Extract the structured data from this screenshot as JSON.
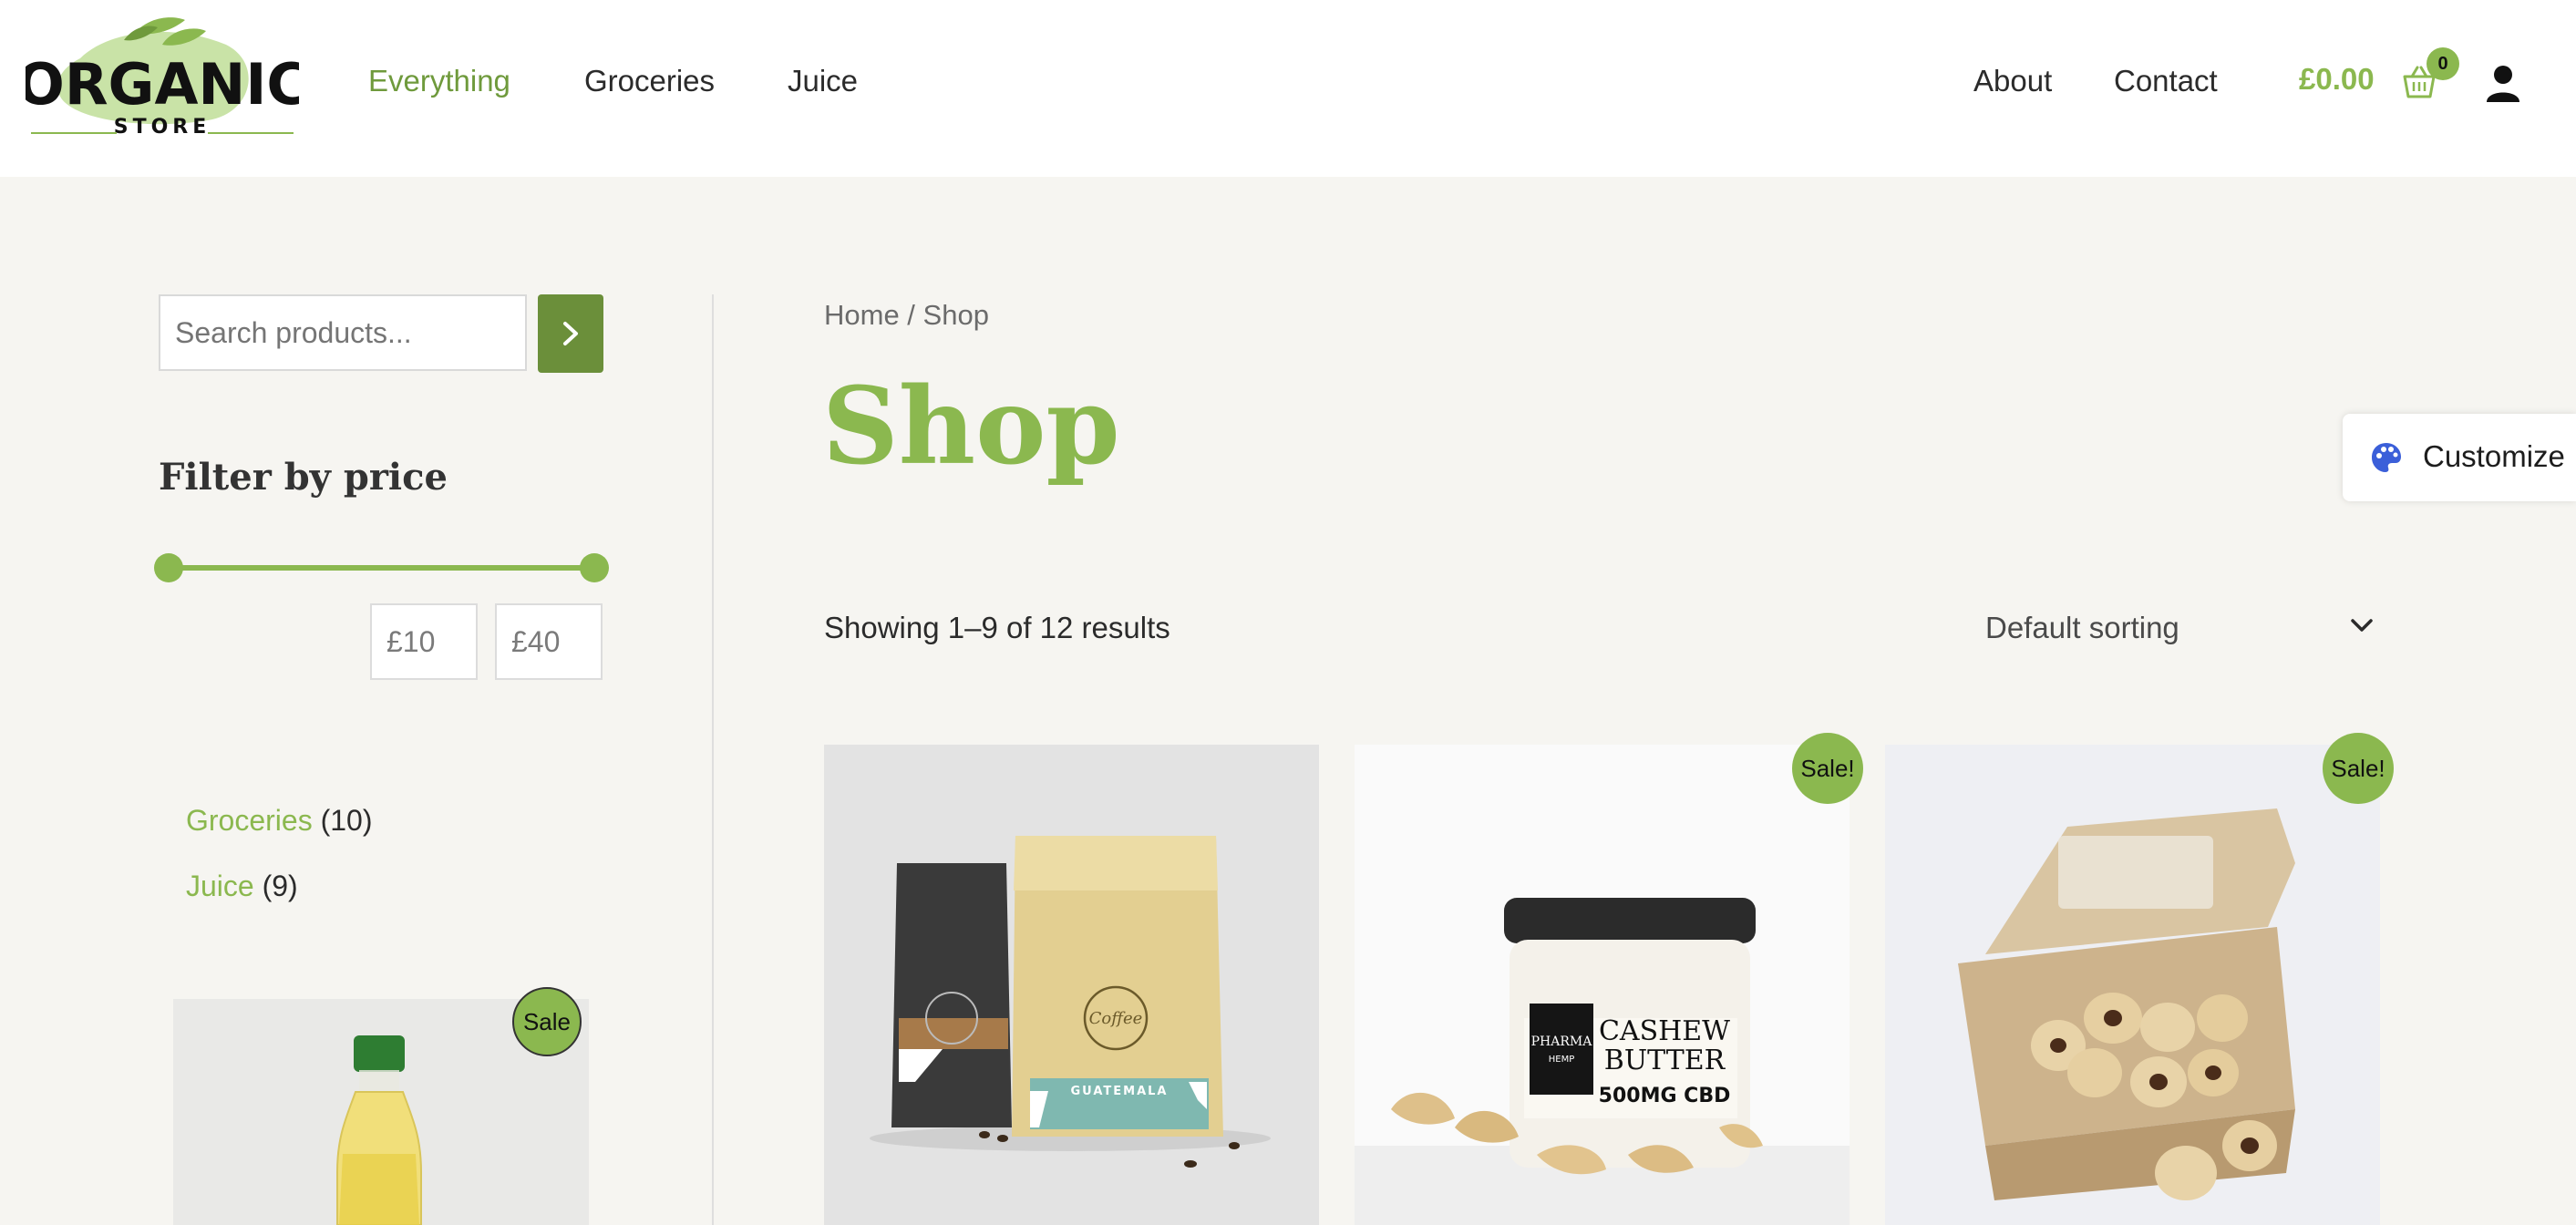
{
  "header": {
    "logo": {
      "line1": "ORGANIC",
      "line2": "STORE"
    },
    "nav": [
      "Everything",
      "Groceries",
      "Juice"
    ],
    "right_nav": [
      "About",
      "Contact"
    ],
    "cart_amount": "£0.00",
    "cart_count": "0"
  },
  "sidebar": {
    "search_placeholder": "Search products...",
    "filter_title": "Filter by price",
    "price_min": "£10",
    "price_max": "£40",
    "categories": [
      {
        "name": "Groceries",
        "count": "(10)"
      },
      {
        "name": "Juice",
        "count": "(9)"
      }
    ],
    "product_badge": "Sale"
  },
  "main": {
    "breadcrumb": "Home / Shop",
    "title": "Shop",
    "result_count": "Showing 1–9 of 12 results",
    "sorting": "Default sorting",
    "products": [
      {
        "badge": "",
        "image_text": [
          "GUATEMALA",
          "Coffee"
        ]
      },
      {
        "badge": "Sale!",
        "image_text": [
          "PHARMA",
          "HEMP",
          "CASHEW",
          "BUTTER",
          "500MG CBD"
        ]
      },
      {
        "badge": "Sale!",
        "image_text": []
      }
    ]
  },
  "customize": {
    "label": "Customize"
  },
  "colors": {
    "accent": "#8bb84f",
    "dark_accent": "#6b8f3a",
    "background": "#f6f5f1"
  }
}
